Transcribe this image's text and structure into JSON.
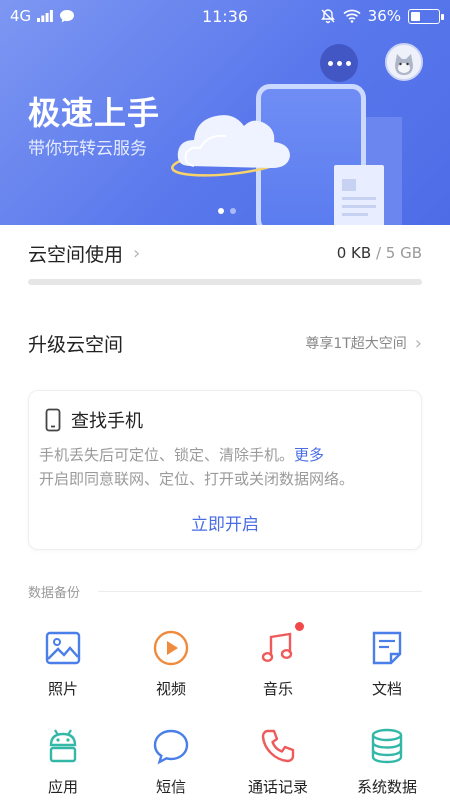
{
  "status_bar": {
    "network": "4G",
    "time": "11:36",
    "battery": "36%"
  },
  "hero": {
    "title": "极速上手",
    "subtitle": "带你玩转云服务"
  },
  "usage": {
    "title": "云空间使用",
    "used": "0 KB",
    "separator": " / ",
    "total": "5 GB",
    "progress_fraction": 0
  },
  "upgrade": {
    "title": "升级云空间",
    "hint": "尊享1T超大空间"
  },
  "find_phone": {
    "title": "查找手机",
    "desc_line1": "手机丢失后可定位、锁定、清除手机。",
    "more_link": "更多",
    "desc_line2": "开启即同意联网、定位、打开或关闭数据网络。",
    "action": "立即开启"
  },
  "backup": {
    "section_label": "数据备份",
    "items": [
      {
        "label": "照片",
        "icon": "photo-icon",
        "color": "#4a7ee8"
      },
      {
        "label": "视频",
        "icon": "video-icon",
        "color": "#f08a3c"
      },
      {
        "label": "音乐",
        "icon": "music-icon",
        "color": "#ef5a5a"
      },
      {
        "label": "文档",
        "icon": "document-icon",
        "color": "#4a7ee8"
      },
      {
        "label": "应用",
        "icon": "android-app-icon",
        "color": "#33b8a8"
      },
      {
        "label": "短信",
        "icon": "message-icon",
        "color": "#4a7ee8"
      },
      {
        "label": "通话记录",
        "icon": "phone-call-icon",
        "color": "#ef5a5a"
      },
      {
        "label": "系统数据",
        "icon": "database-icon",
        "color": "#33b8a8"
      }
    ]
  },
  "colors": {
    "accent": "#4a6de5",
    "banner": "#5a78ec",
    "badge": "#f2484b"
  }
}
